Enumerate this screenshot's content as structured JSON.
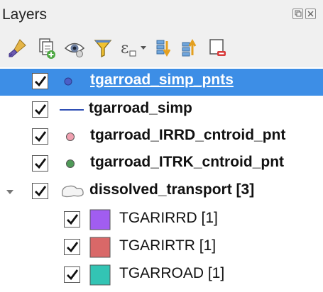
{
  "panel": {
    "title": "Layers"
  },
  "title_buttons": [
    "restore",
    "close"
  ],
  "toolbar": [
    "style-paint-icon",
    "add-group-icon",
    "visibility-eye-icon",
    "filter-funnel-icon",
    "expression-filter-icon",
    "expand-all-icon",
    "collapse-all-icon",
    "remove-layer-icon"
  ],
  "layers": {
    "l1": {
      "name": "tgarroad_simp_pnts",
      "checked": true,
      "selected": true,
      "symbol": "point",
      "color": "#4a5fc8"
    },
    "l2": {
      "name": "tgarroad_simp",
      "checked": true,
      "symbol": "line",
      "color": "#2f4fb5"
    },
    "l3": {
      "name": "tgarroad_IRRD_cntroid_pnt",
      "checked": true,
      "symbol": "point",
      "color": "#f0a0b0"
    },
    "l4": {
      "name": "tgarroad_ITRK_cntroid_pnt",
      "checked": true,
      "symbol": "point",
      "color": "#4f9a58"
    },
    "l5": {
      "name": "dissolved_transport [3]",
      "checked": true,
      "expanded": true,
      "symbol": "polygon-group",
      "classes": {
        "c1": {
          "label": "TGARIRRD [1]",
          "checked": true,
          "color": "#a15df0"
        },
        "c2": {
          "label": "TGARIRTR [1]",
          "checked": true,
          "color": "#d96868"
        },
        "c3": {
          "label": "TGARROAD [1]",
          "checked": true,
          "color": "#33c4b4"
        }
      }
    }
  }
}
